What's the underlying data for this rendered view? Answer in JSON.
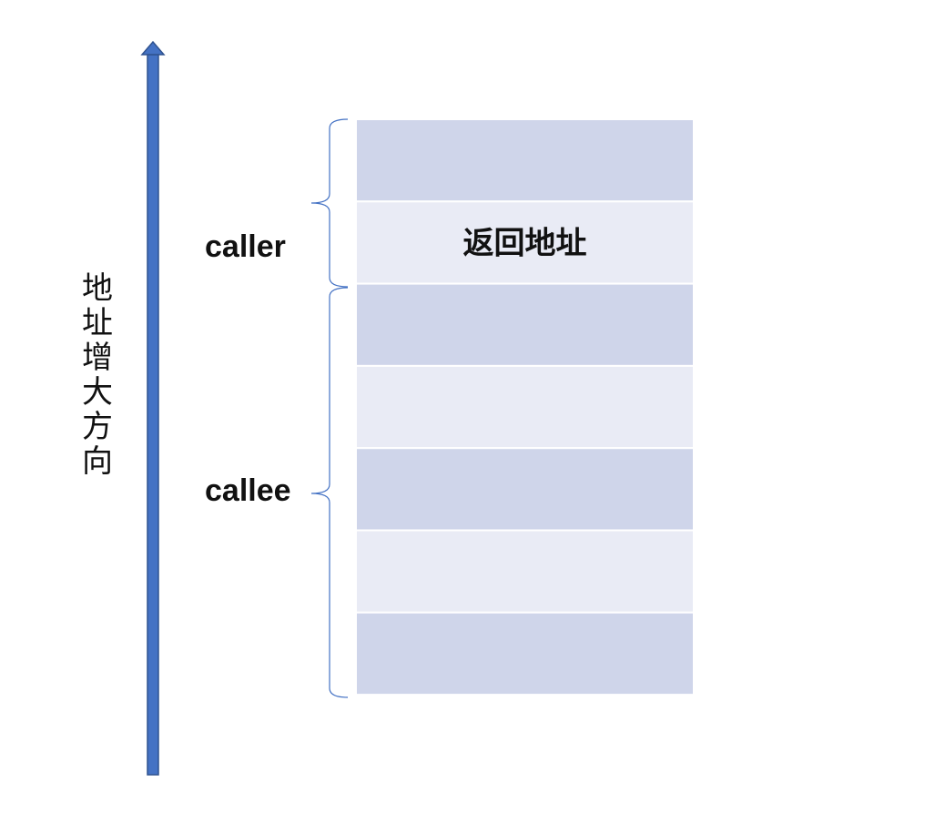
{
  "axis": {
    "label": "地址增大方向",
    "arrow_color": "#4472c4",
    "arrow_outline": "#2f528f"
  },
  "stack": {
    "cells": [
      {
        "label": "",
        "fill": "#cfd5ea"
      },
      {
        "label": "返回地址",
        "fill": "#e9ebf5"
      },
      {
        "label": "",
        "fill": "#cfd5ea"
      },
      {
        "label": "",
        "fill": "#e9ebf5"
      },
      {
        "label": "",
        "fill": "#cfd5ea"
      },
      {
        "label": "",
        "fill": "#e9ebf5"
      },
      {
        "label": "",
        "fill": "#cfd5ea"
      }
    ]
  },
  "brackets": {
    "caller": {
      "label": "caller"
    },
    "callee": {
      "label": "callee"
    },
    "stroke": "#4472c4"
  }
}
